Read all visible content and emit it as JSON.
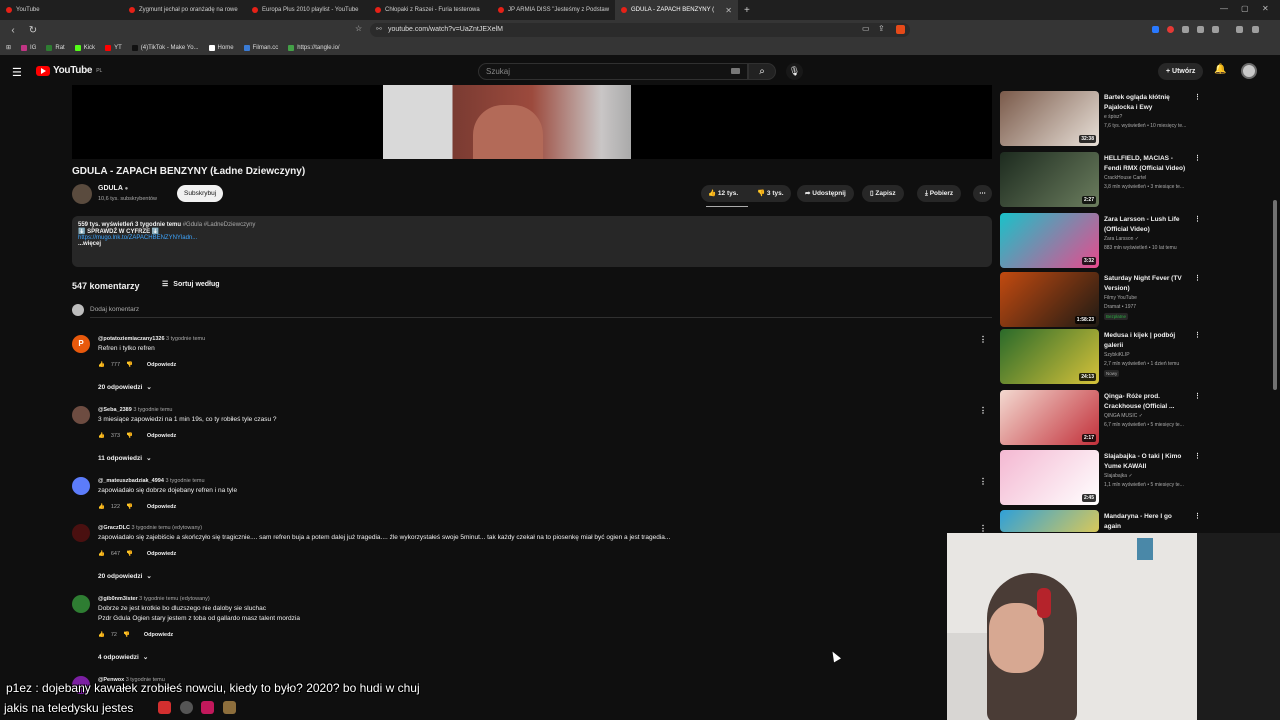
{
  "browser": {
    "tabs": [
      {
        "title": "YouTube",
        "active": false
      },
      {
        "title": "Zygmunt jechał po oranżadę na rowe",
        "active": false
      },
      {
        "title": "Europa Plus 2010 playlist - YouTube",
        "active": false
      },
      {
        "title": "Chłopaki z Raszei - Furia testerowa",
        "active": false
      },
      {
        "title": "JP ARMIA DISS \"Jesteśmy z Podstaw",
        "active": false
      },
      {
        "title": "GDULA - ZAPACH BENZYNY (",
        "active": true
      }
    ],
    "new_tab": "+",
    "url": "youtube.com/watch?v=UaZntJEXelM",
    "bookmarks": [
      {
        "label": "IG",
        "color": "#c13584"
      },
      {
        "label": "Rat",
        "color": "#2e7d32"
      },
      {
        "label": "Kick",
        "color": "#53fc18"
      },
      {
        "label": "YT",
        "color": "#ff0000"
      },
      {
        "label": "(4)TikTok - Make Yo...",
        "color": "#111111"
      },
      {
        "label": "Home",
        "color": "#ffffff"
      },
      {
        "label": "Filman.cc",
        "color": "#3a7bd5"
      },
      {
        "label": "https://tangle.io/",
        "color": "#43a047"
      }
    ]
  },
  "header": {
    "logo": "YouTube",
    "region": "PL",
    "search_placeholder": "Szukaj",
    "create_label": "Utwórz"
  },
  "video": {
    "title": "GDULA - ZAPACH BENZYNY (Ładne Dziewczyny)",
    "channel": "GDULA",
    "subscribers": "10,6 tys. subskrybentów",
    "subscribe_label": "Subskrybuj",
    "likes": "12 tys.",
    "dislikes": "3 tys.",
    "share_label": "Udostępnij",
    "save_label": "Zapisz",
    "download_label": "Pobierz",
    "description": {
      "views_time": "559 tys. wyświetleń  3 tygodnie temu",
      "tags": "#Gdula #LadneDziewczyny",
      "line2": "⬇️ SPRAWDŹ W CYFRZE ⬇️",
      "link": "https://mugo.lnk.to/ZAPACHBENZYNYladn...",
      "more": "...więcej"
    }
  },
  "comments": {
    "count": "547 komentarzy",
    "sort_label": "Sortuj według",
    "add_placeholder": "Dodaj komentarz",
    "reply_label": "Odpowiedz",
    "items": [
      {
        "user": "@potatoziemiaczany1326",
        "time": "3 tygodnie temu",
        "text": "Refren i tylko refren",
        "text2": "",
        "likes": "777",
        "replies": "20 odpowiedzi",
        "avatar_letter": "P",
        "avatar_color": "#e8590c"
      },
      {
        "user": "@Seba_2389",
        "time": "3 tygodnie temu",
        "text": "3 miesiące zapowiedzi na 1 min 19s, co ty robiłeś tyle czasu ?",
        "text2": "",
        "likes": "373",
        "replies": "11 odpowiedzi",
        "avatar_letter": "",
        "avatar_color": "#6d4c41"
      },
      {
        "user": "@_mateuszbadziak_4994",
        "time": "3 tygodnie temu",
        "text": "zapowiadało się dobrze dojebany refren i na tyle",
        "text2": "",
        "likes": "122",
        "replies": "",
        "avatar_letter": "",
        "avatar_color": "#5c7cfa"
      },
      {
        "user": "@GraczDLC",
        "time": "3 tygodnie temu (edytowany)",
        "text": "zapowiadało się zajebiście a skończyło się tragicznie.... sam refren buja a potem dalej już tragedia.... źle wykorzystałeś swoje 5minut... tak każdy czekał na to piosenkę miał być ogien a jest tragedia...",
        "text2": "",
        "likes": "647",
        "replies": "20 odpowiedzi",
        "avatar_letter": "",
        "avatar_color": "#4a1010"
      },
      {
        "user": "@gib0nm3ister",
        "time": "3 tygodnie temu (edytowany)",
        "text": "Dobrze ze jest krotkie bo dluzszego nie daloby sie sluchac",
        "text2": "Pzdr Gdula Ogien stary jestem z toba od gallardo masz talent mordzia",
        "likes": "72",
        "replies": "4 odpowiedzi",
        "avatar_letter": "",
        "avatar_color": "#2e7d32"
      },
      {
        "user": "@Penwox",
        "time": "3 tygodnie temu",
        "text": "",
        "text2": "",
        "likes": "",
        "replies": "",
        "avatar_letter": "",
        "avatar_color": "#7b1fa2"
      }
    ]
  },
  "sidebar": [
    {
      "title": "Bartek ogląda kłótnię Pajalocka i Ewy",
      "channel": "e śpisz?",
      "meta": "7,6 tys. wyświetleń • 10 miesięcy te...",
      "duration": "32:38",
      "badge": "",
      "c1": "#7a5a4a",
      "c2": "#e8e0d8"
    },
    {
      "title": "HELLFIELD, MACIAS - Fendi RMX (Official Video)",
      "channel": "CrackHouse Cartel",
      "meta": "3,8 mln wyświetleń • 3 miesiące te...",
      "duration": "2:27",
      "badge": "",
      "c1": "#1d2b1f",
      "c2": "#6b7d5e"
    },
    {
      "title": "Zara Larsson - Lush Life (Official Video)",
      "channel": "Zara Larsson ✓",
      "meta": "883 mln wyświetleń • 10 lat temu",
      "duration": "3:32",
      "badge": "",
      "c1": "#19c2c9",
      "c2": "#e84a8d"
    },
    {
      "title": "Saturday Night Fever (TV Version)",
      "channel": "Filmy YouTube",
      "meta": "Dramat • 1977",
      "duration": "1:58:23",
      "badge": "Bezpłatne",
      "c1": "#c24a10",
      "c2": "#1e1a14"
    },
    {
      "title": "Medusa i kijek | podbój galerii",
      "channel": "SzybkiKLIP",
      "meta": "2,7 mln wyświetleń • 1 dzień temu",
      "duration": "24:13",
      "badge": "Nowy",
      "c1": "#2a6a2a",
      "c2": "#d6c23a"
    },
    {
      "title": "Qinga- Róże prod. Crackhouse (Official ...",
      "channel": "QINGA MUSIC ✓",
      "meta": "6,7 mln wyświetleń • 5 miesięcy te...",
      "duration": "2:17",
      "badge": "",
      "c1": "#f3d9d0",
      "c2": "#c2303a"
    },
    {
      "title": "Slajabajka - O taki | Kimo Yume KAWAII",
      "channel": "Slajabajka ✓",
      "meta": "1,1 mln wyświetleń • 5 miesięcy te...",
      "duration": "2:45",
      "badge": "",
      "c1": "#f4b8d2",
      "c2": "#ffffff"
    },
    {
      "title": "Mandaryna - Here I go again",
      "channel": "",
      "meta": "",
      "duration": "",
      "badge": "",
      "c1": "#2fa0d8",
      "c2": "#d8c85a"
    }
  ],
  "stream_chat": {
    "line1_user": "p1ez",
    "line1_text": "dojebany kawałek zrobiłeś nowciu, kiedy to było? 2020? bo hudi w chuj",
    "line2_text": "jakis na teledysku jestes"
  }
}
